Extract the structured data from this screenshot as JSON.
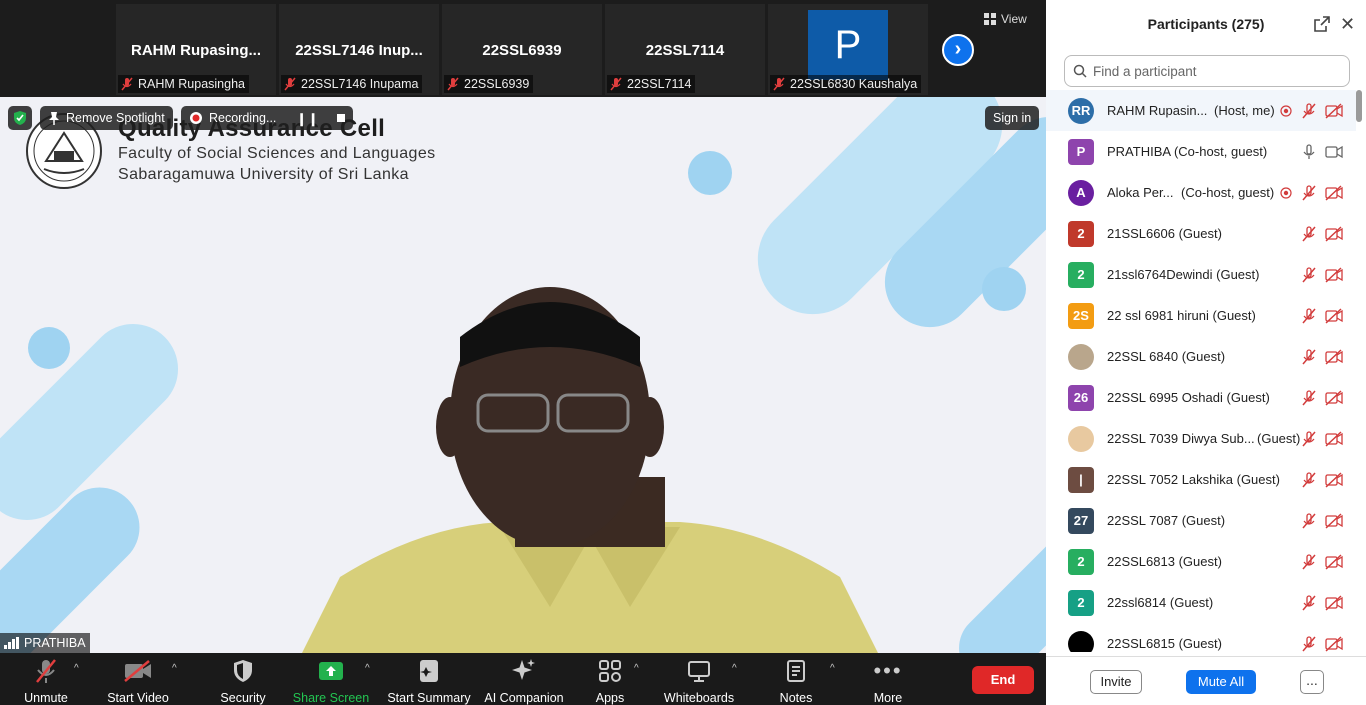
{
  "strip": {
    "thumbnails": [
      {
        "name": "RAHM  Rupasing...",
        "label": "RAHM Rupasingha"
      },
      {
        "name": "22SSL7146  Inup...",
        "label": "22SSL7146 Inupama"
      },
      {
        "name": "22SSL6939",
        "label": "22SSL6939"
      },
      {
        "name": "22SSL7114",
        "label": "22SSL7114"
      },
      {
        "avatar_letter": "P",
        "label": "22SSL6830 Kaushalya"
      }
    ],
    "view_label": "View"
  },
  "stage": {
    "org_title": "Quality Assurance Cell",
    "org_line1": "Faculty of Social Sciences and Languages",
    "org_line2": "Sabaragamuwa University of Sri Lanka",
    "remove_spotlight": "Remove Spotlight",
    "recording": "Recording...",
    "sign_in": "Sign in",
    "speaker_name": "PRATHIBA"
  },
  "toolbar": {
    "unmute": "Unmute",
    "start_video": "Start Video",
    "security": "Security",
    "share_screen": "Share Screen",
    "start_summary": "Start Summary",
    "ai_companion": "AI Companion",
    "apps": "Apps",
    "whiteboards": "Whiteboards",
    "notes": "Notes",
    "more": "More",
    "end": "End"
  },
  "panel": {
    "title": "Participants (275)",
    "search_placeholder": "Find a participant",
    "participants": [
      {
        "avatar": "RR",
        "color": "#2d6ea8",
        "name": "RAHM Rupasin...",
        "role": "(Host, me)",
        "recording": true,
        "mic": "muted",
        "video": "off"
      },
      {
        "avatar": "P",
        "color": "#8e44ad",
        "name": "PRATHIBA (Co-host, guest)",
        "role": "",
        "recording": false,
        "mic": "on",
        "video": "on"
      },
      {
        "avatar": "A",
        "color": "#6a1fa0",
        "name": "Aloka Per...",
        "role": "(Co-host, guest)",
        "recording": true,
        "mic": "muted",
        "video": "off"
      },
      {
        "avatar": "2",
        "color": "#c0392b",
        "name": "21SSL6606 (Guest)",
        "role": "",
        "recording": false,
        "mic": "muted",
        "video": "off"
      },
      {
        "avatar": "2",
        "color": "#27ae60",
        "name": "21ssl6764Dewindi (Guest)",
        "role": "",
        "recording": false,
        "mic": "muted",
        "video": "off"
      },
      {
        "avatar": "2S",
        "color": "#f39c12",
        "name": "22 ssl 6981 hiruni (Guest)",
        "role": "",
        "recording": false,
        "mic": "muted",
        "video": "off"
      },
      {
        "avatar": "",
        "color": "#b9a68c",
        "name": "22SSL 6840 (Guest)",
        "role": "",
        "recording": false,
        "mic": "muted",
        "video": "off"
      },
      {
        "avatar": "26",
        "color": "#8e44ad",
        "name": "22SSL 6995 Oshadi (Guest)",
        "role": "",
        "recording": false,
        "mic": "muted",
        "video": "off"
      },
      {
        "avatar": "",
        "color": "#e8c9a0",
        "name": "22SSL 7039 Diwya Sub...",
        "role": "(Guest)",
        "recording": false,
        "mic": "muted",
        "video": "off"
      },
      {
        "avatar": "|",
        "color": "#6d4c41",
        "name": "22SSL 7052 Lakshika (Guest)",
        "role": "",
        "recording": false,
        "mic": "muted",
        "video": "off"
      },
      {
        "avatar": "27",
        "color": "#34495e",
        "name": "22SSL 7087 (Guest)",
        "role": "",
        "recording": false,
        "mic": "muted",
        "video": "off"
      },
      {
        "avatar": "2",
        "color": "#27ae60",
        "name": "22SSL6813 (Guest)",
        "role": "",
        "recording": false,
        "mic": "muted",
        "video": "off"
      },
      {
        "avatar": "2",
        "color": "#16a085",
        "name": "22ssl6814 (Guest)",
        "role": "",
        "recording": false,
        "mic": "muted",
        "video": "off"
      },
      {
        "avatar": "",
        "color": "#000000",
        "name": "22SSL6815 (Guest)",
        "role": "",
        "recording": false,
        "mic": "muted",
        "video": "off"
      }
    ],
    "invite": "Invite",
    "mute_all": "Mute All",
    "more": "..."
  }
}
